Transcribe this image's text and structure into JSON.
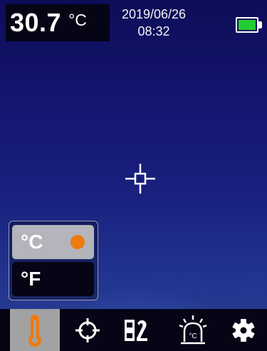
{
  "status": {
    "temperature": "30.7",
    "temperature_unit": "°C",
    "date": "2019/06/26",
    "time": "08:32",
    "battery_level": 1.0
  },
  "unit_menu": {
    "options": [
      {
        "label": "°C",
        "selected": true
      },
      {
        "label": "°F",
        "selected": false
      }
    ]
  },
  "toolbar": {
    "items": [
      {
        "icon": "thermometer-icon",
        "active": true
      },
      {
        "icon": "crosshair-target-icon",
        "active": false
      },
      {
        "icon": "color-palette-icon",
        "active": false
      },
      {
        "icon": "temperature-alarm-icon",
        "active": false
      },
      {
        "icon": "settings-gear-icon",
        "active": false
      }
    ]
  },
  "colors": {
    "selection_dot": "#ee7a12",
    "active_tool_bg": "#a2a2a2",
    "battery_fill": "#22cc33",
    "thermometer": "#ee7a12"
  }
}
